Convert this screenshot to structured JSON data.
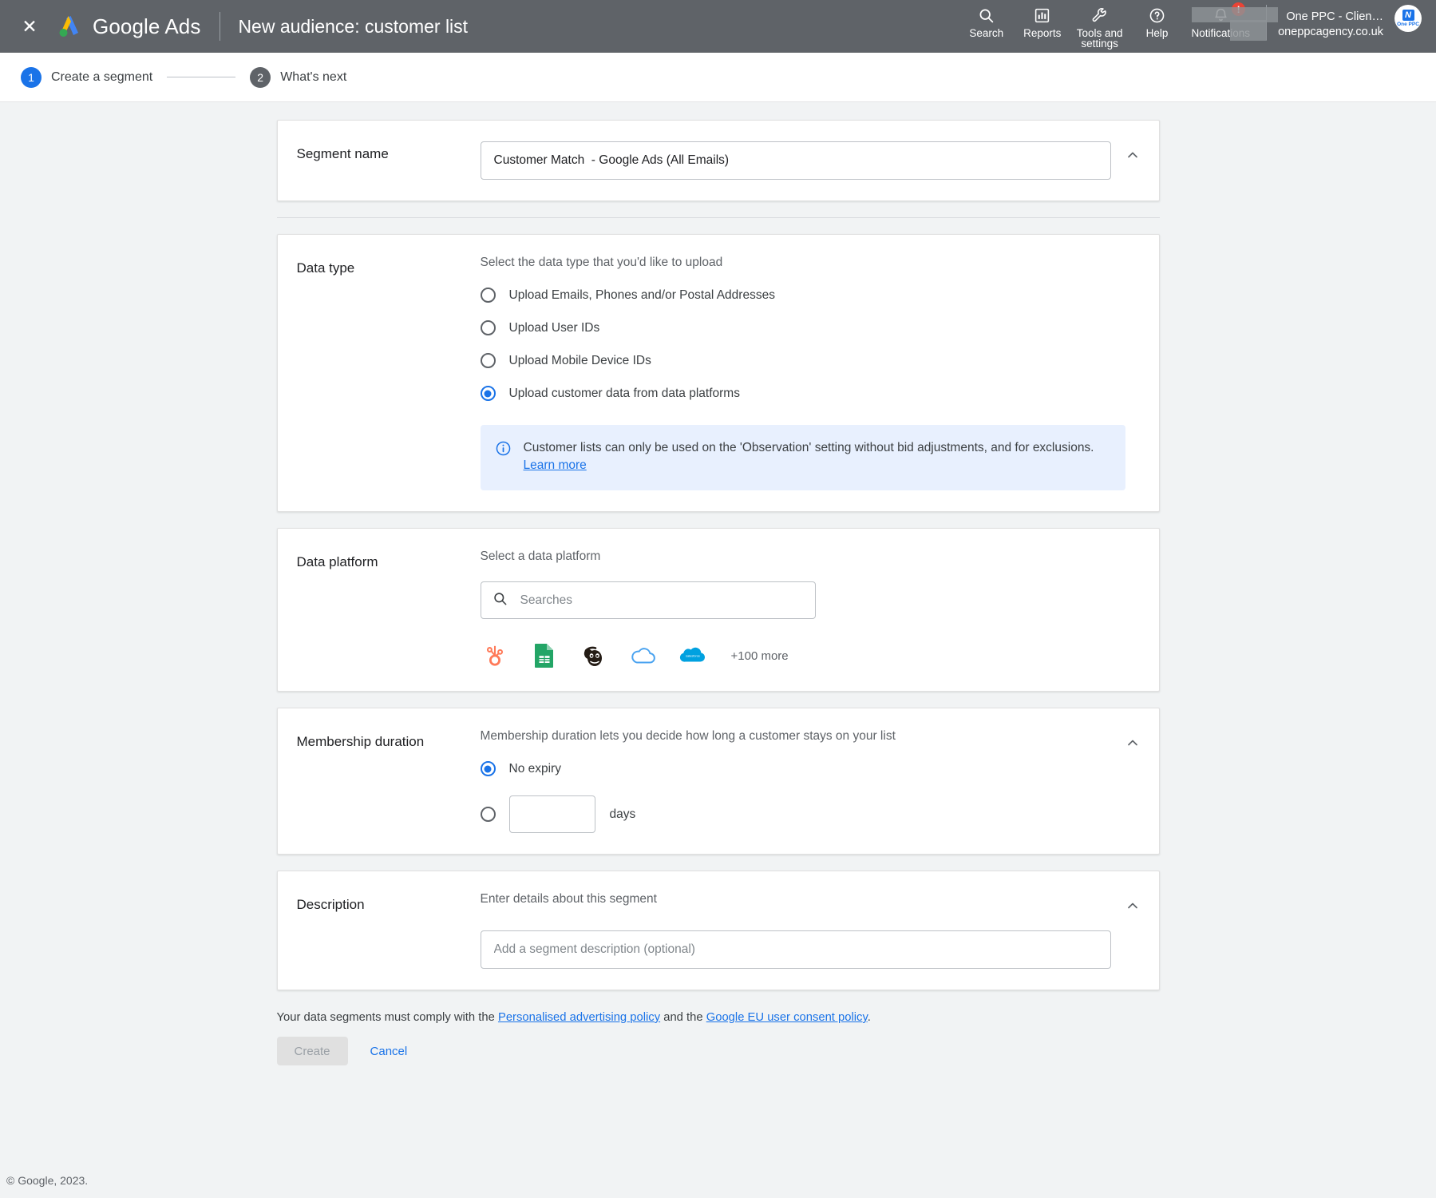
{
  "appbar": {
    "close_icon": "close-icon",
    "brand": "Google Ads",
    "page_title": "New audience: customer list",
    "items": [
      {
        "icon": "search-icon",
        "label": "Search"
      },
      {
        "icon": "reports-icon",
        "label": "Reports"
      },
      {
        "icon": "wrench-icon",
        "label": "Tools and\nsettings"
      },
      {
        "icon": "help-icon",
        "label": "Help"
      },
      {
        "icon": "bell-icon",
        "label": "Notifications",
        "badge": "!"
      }
    ],
    "account": {
      "name": "One PPC - Clien…",
      "domain": "oneppcagency.co.uk",
      "avatar_initial": "N",
      "avatar_text": "One PPC"
    }
  },
  "stepper": {
    "steps": [
      {
        "number": "1",
        "label": "Create a segment",
        "state": "active"
      },
      {
        "number": "2",
        "label": "What's next",
        "state": "inactive"
      }
    ]
  },
  "segment_name": {
    "label": "Segment name",
    "value": "Customer Match  - Google Ads (All Emails)",
    "placeholder": "Segment name",
    "collapse_icon": "chevron-up-icon"
  },
  "data_type": {
    "label": "Data type",
    "helper": "Select the data type that you'd like to upload",
    "options": [
      {
        "label": "Upload Emails, Phones and/or Postal Addresses",
        "selected": false
      },
      {
        "label": "Upload User IDs",
        "selected": false
      },
      {
        "label": "Upload Mobile Device IDs",
        "selected": false
      },
      {
        "label": "Upload customer data from data platforms",
        "selected": true
      }
    ],
    "info": {
      "icon": "info-icon",
      "text": "Customer lists can only be used on the 'Observation' setting without bid adjustments, and for exclusions.",
      "link": "Learn more"
    }
  },
  "data_platform": {
    "label": "Data platform",
    "helper": "Select a data platform",
    "search_placeholder": "Searches",
    "search_value": "",
    "search_icon": "search-icon",
    "platforms": [
      {
        "name": "hubspot-icon",
        "title": "HubSpot"
      },
      {
        "name": "google-sheets-icon",
        "title": "Google Sheets"
      },
      {
        "name": "mailchimp-icon",
        "title": "Mailchimp"
      },
      {
        "name": "cloud-icon",
        "title": "Cloud"
      },
      {
        "name": "salesforce-icon",
        "title": "Salesforce"
      }
    ],
    "more_label": "+100 more"
  },
  "membership_duration": {
    "label": "Membership duration",
    "helper": "Membership duration lets you decide how long a customer stays on your list",
    "no_expiry_label": "No expiry",
    "no_expiry_selected": true,
    "days_selected": false,
    "days_value": "",
    "days_label": "days",
    "collapse_icon": "chevron-up-icon"
  },
  "description": {
    "label": "Description",
    "helper": "Enter details about this segment",
    "placeholder": "Add a segment description (optional)",
    "value": "",
    "collapse_icon": "chevron-up-icon"
  },
  "footer": {
    "policy_prefix": "Your data segments must comply with the ",
    "policy_link_1": "Personalised advertising policy",
    "policy_middle": " and the ",
    "policy_link_2": "Google EU user consent policy",
    "policy_suffix": ".",
    "create_label": "Create",
    "cancel_label": "Cancel",
    "copyright": "© Google, 2023."
  },
  "colors": {
    "appbar_bg": "#5f6368",
    "accent_blue": "#1a73e8",
    "info_bg": "#e8f0fe",
    "page_bg": "#f1f3f4",
    "badge_red": "#ea4335"
  }
}
